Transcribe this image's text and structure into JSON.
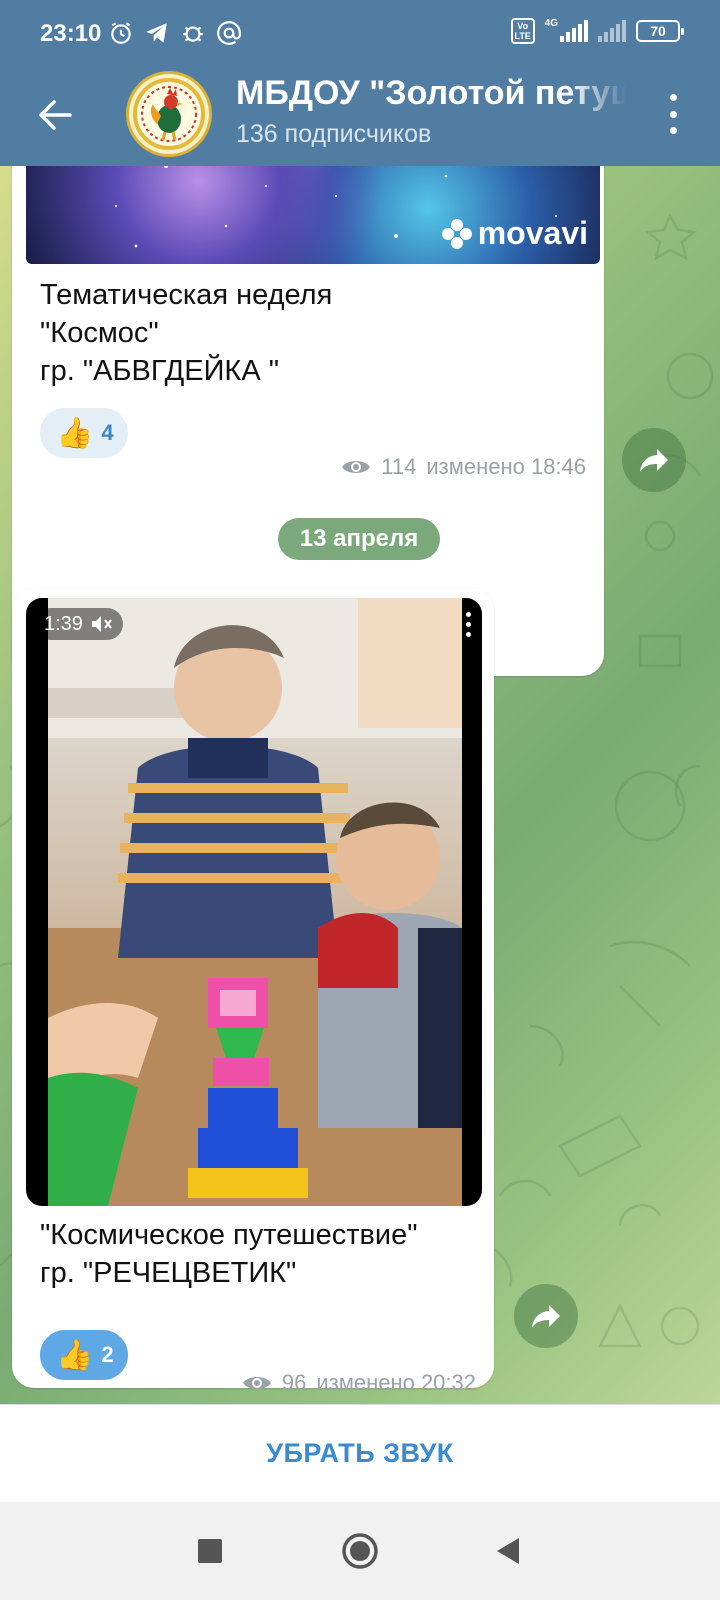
{
  "status_bar": {
    "time": "23:10",
    "battery": "70",
    "network": "4G",
    "volte": "Vo LTE"
  },
  "header": {
    "channel_title": "МБДОУ \"Золотой петушок\"",
    "subscribers": "136 подписчиков",
    "back_icon": "arrow-left-icon",
    "menu_icon": "more-vertical-icon"
  },
  "messages": [
    {
      "media_watermark": "movavi",
      "text": "Тематическая неделя\n\"Космос\"\nгр. \"АБВГДЕЙКА \"",
      "reaction": {
        "emoji": "👍",
        "count": "4"
      },
      "views": "114",
      "edited": "изменено 18:46"
    },
    {
      "video_duration": "1:39",
      "text": "\"Космическое путешествие\"\nгр. \"РЕЧЕЦВЕТИК\"",
      "reaction": {
        "emoji": "👍",
        "count": "2"
      },
      "views": "96",
      "edited": "изменено 20:32"
    }
  ],
  "date_separator": "13 апреля",
  "bottom_bar": {
    "mute_label": "УБРАТЬ ЗВУК"
  },
  "colors": {
    "header_bg": "#527da3",
    "accent_blue": "#3a8bd0",
    "reaction_active": "#5ea8e6"
  }
}
